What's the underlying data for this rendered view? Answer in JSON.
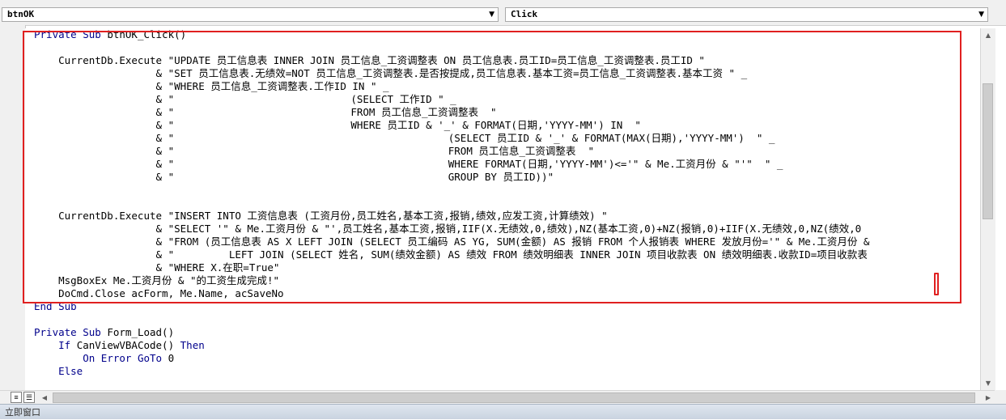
{
  "toolbar": {
    "object_combo": "btnOK",
    "procedure_combo": "Click",
    "dropdown_icon": "chevron-down-icon"
  },
  "code_lines": [
    "Private Sub btnOK_Click()",
    "",
    "    CurrentDb.Execute \"UPDATE 员工信息表 INNER JOIN 员工信息_工资调整表 ON 员工信息表.员工ID=员工信息_工资调整表.员工ID \"",
    "                    & \"SET 员工信息表.无绩效=NOT 员工信息_工资调整表.是否按提成,员工信息表.基本工资=员工信息_工资调整表.基本工资 \" _",
    "                    & \"WHERE 员工信息_工资调整表.工作ID IN \" _",
    "                    & \"                             (SELECT 工作ID \" _",
    "                    & \"                             FROM 员工信息_工资调整表  \"",
    "                    & \"                             WHERE 员工ID & '_' & FORMAT(日期,'YYYY-MM') IN  \"",
    "                    & \"                                             (SELECT 员工ID & '_' & FORMAT(MAX(日期),'YYYY-MM')  \" _",
    "                    & \"                                             FROM 员工信息_工资调整表  \"",
    "                    & \"                                             WHERE FORMAT(日期,'YYYY-MM')<='\" & Me.工资月份 & \"'\"  \" _",
    "                    & \"                                             GROUP BY 员工ID))\"",
    "",
    "",
    "    CurrentDb.Execute \"INSERT INTO 工资信息表 (工资月份,员工姓名,基本工资,报销,绩效,应发工资,计算绩效) \"",
    "                    & \"SELECT '\" & Me.工资月份 & \"',员工姓名,基本工资,报销,IIF(X.无绩效,0,绩效),NZ(基本工资,0)+NZ(报销,0)+IIF(X.无绩效,0,NZ(绩效,0",
    "                    & \"FROM (员工信息表 AS X LEFT JOIN (SELECT 员工编码 AS YG, SUM(金额) AS 报销 FROM 个人报销表 WHERE 发放月份='\" & Me.工资月份 &",
    "                    & \"         LEFT JOIN (SELECT 姓名, SUM(绩效金额) AS 绩效 FROM 绩效明细表 INNER JOIN 项目收款表 ON 绩效明细表.收款ID=项目收款表",
    "                    & \"WHERE X.在职=True\"",
    "    MsgBoxEx Me.工资月份 & \"的工资生成完成!\"",
    "    DoCmd.Close acForm, Me.Name, acSaveNo",
    "End Sub",
    "",
    "Private Sub Form_Load()",
    "    If CanViewVBACode() Then",
    "        On Error GoTo 0",
    "    Else"
  ],
  "status": {
    "immediate_window": "立即窗口"
  },
  "colors": {
    "keyword": "#00008b",
    "highlight_box": "#e02020"
  }
}
